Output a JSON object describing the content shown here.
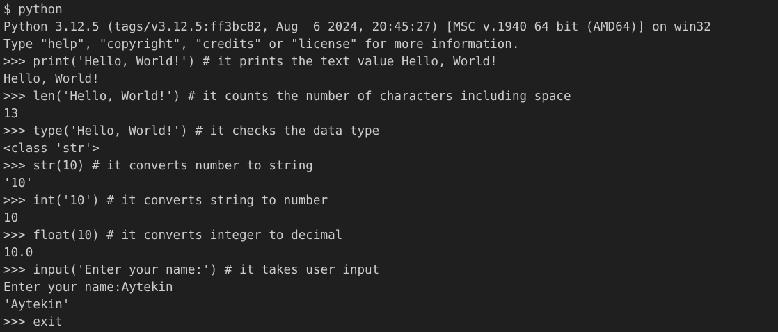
{
  "terminal": {
    "lines": [
      {
        "type": "shell",
        "prompt": "$ ",
        "text": "python"
      },
      {
        "type": "output",
        "text": "Python 3.12.5 (tags/v3.12.5:ff3bc82, Aug  6 2024, 20:45:27) [MSC v.1940 64 bit (AMD64)] on win32"
      },
      {
        "type": "output",
        "text": "Type \"help\", \"copyright\", \"credits\" or \"license\" for more information."
      },
      {
        "type": "input",
        "prompt": ">>> ",
        "text": "print('Hello, World!') # it prints the text value Hello, World!"
      },
      {
        "type": "output",
        "text": "Hello, World!"
      },
      {
        "type": "input",
        "prompt": ">>> ",
        "text": "len('Hello, World!') # it counts the number of characters including space"
      },
      {
        "type": "output",
        "text": "13"
      },
      {
        "type": "input",
        "prompt": ">>> ",
        "text": "type('Hello, World!') # it checks the data type"
      },
      {
        "type": "output",
        "text": "<class 'str'>"
      },
      {
        "type": "input",
        "prompt": ">>> ",
        "text": "str(10) # it converts number to string"
      },
      {
        "type": "output",
        "text": "'10'"
      },
      {
        "type": "input",
        "prompt": ">>> ",
        "text": "int('10') # it converts string to number"
      },
      {
        "type": "output",
        "text": "10"
      },
      {
        "type": "input",
        "prompt": ">>> ",
        "text": "float(10) # it converts integer to decimal"
      },
      {
        "type": "output",
        "text": "10.0"
      },
      {
        "type": "input",
        "prompt": ">>> ",
        "text": "input('Enter your name:') # it takes user input"
      },
      {
        "type": "output",
        "text": "Enter your name:Aytekin"
      },
      {
        "type": "output",
        "text": "'Aytekin'"
      },
      {
        "type": "input",
        "prompt": ">>> ",
        "text": "exit"
      }
    ]
  },
  "colors": {
    "background": "#1f1f1f",
    "foreground": "#cccccc"
  }
}
